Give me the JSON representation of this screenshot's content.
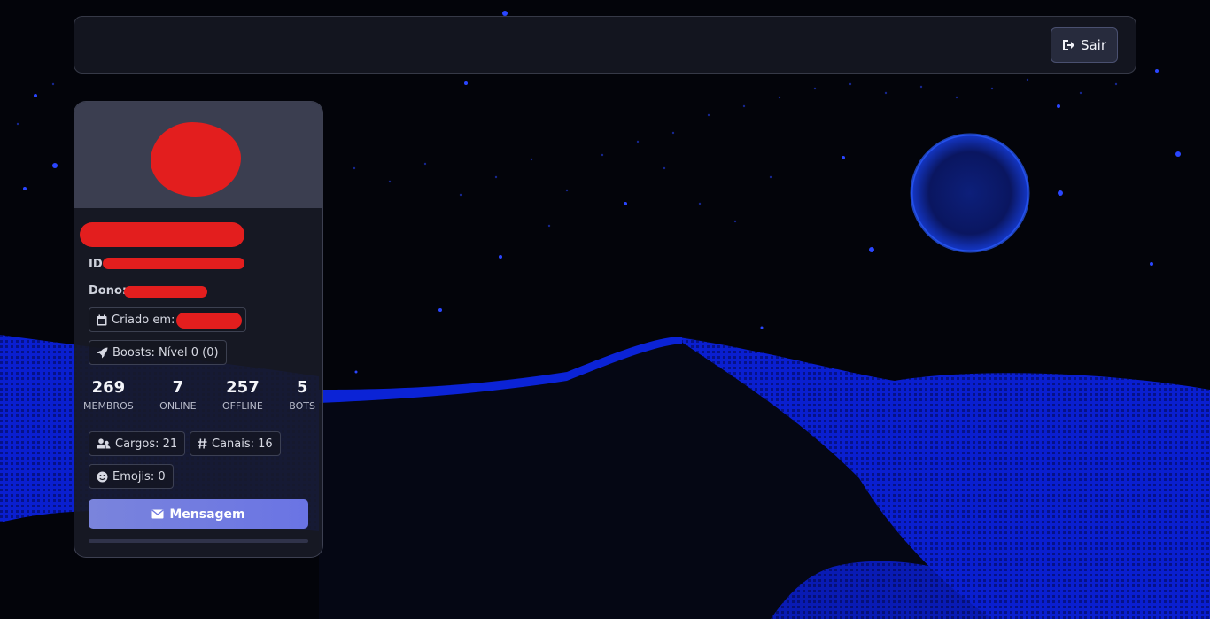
{
  "colors": {
    "accent": "#6a74e4",
    "redaction": "#e31e1e",
    "background": "#03040a",
    "dune_blue": "#0a22d8"
  },
  "topbar": {
    "logout_label": "Sair",
    "logout_icon": "sign-out-icon"
  },
  "server": {
    "id_label": "ID:",
    "owner_label": "Dono:",
    "created_label": "Criado em:",
    "created_icon": "calendar-icon",
    "boosts_label": "Boosts: Nível 0 (0)",
    "boosts_icon": "rocket-icon",
    "stats": [
      {
        "value": "269",
        "label": "MEMBROS"
      },
      {
        "value": "7",
        "label": "ONLINE"
      },
      {
        "value": "257",
        "label": "OFFLINE"
      },
      {
        "value": "5",
        "label": "BOTS"
      }
    ],
    "roles_label": "Cargos: 21",
    "roles_icon": "users-icon",
    "channels_label": "Canais: 16",
    "channels_icon": "hashtag-icon",
    "emojis_label": "Emojis: 0",
    "emojis_icon": "smile-icon",
    "message_button": "Mensagem",
    "message_icon": "envelope-icon",
    "progress": 0
  }
}
